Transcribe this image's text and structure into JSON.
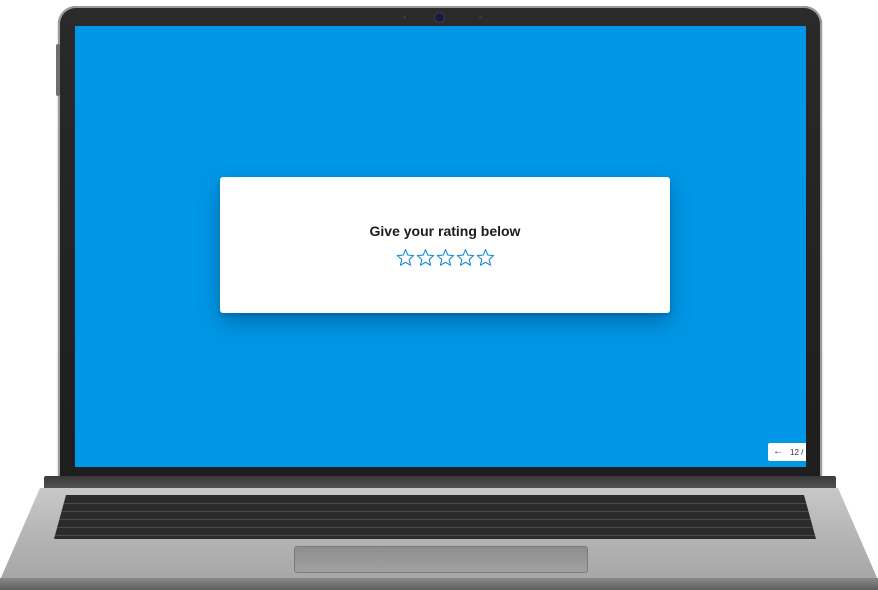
{
  "screen": {
    "background_color": "#0097e6"
  },
  "rating_card": {
    "title": "Give your rating below",
    "stars": [
      {
        "icon": "star-outline-icon",
        "selected": false
      },
      {
        "icon": "star-outline-icon",
        "selected": false
      },
      {
        "icon": "star-outline-icon",
        "selected": false
      },
      {
        "icon": "star-outline-icon",
        "selected": false
      },
      {
        "icon": "star-outline-icon",
        "selected": false
      }
    ],
    "star_color": "#1a8fd6"
  },
  "navigation": {
    "back_icon": "arrow-left-icon",
    "back_glyph": "←",
    "page_counter": "12 /"
  }
}
